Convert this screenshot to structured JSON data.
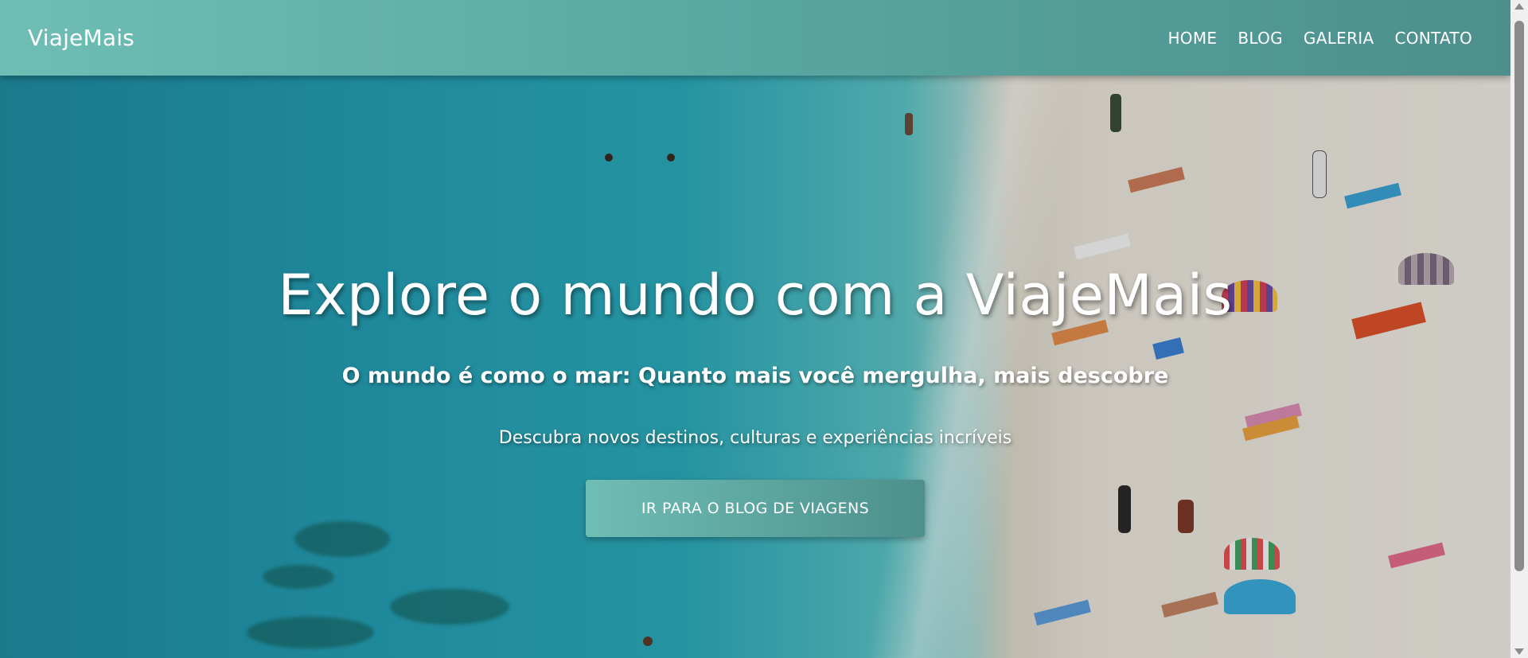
{
  "navbar": {
    "brand": "ViajeMais",
    "links": [
      "HOME",
      "BLOG",
      "GALERIA",
      "CONTATO"
    ]
  },
  "hero": {
    "title": "Explore o mundo com a ViajeMais",
    "subtitle": "O mundo é como o mar: Quanto mais você mergulha, mais descobre",
    "description": "Descubra novos destinos, culturas e experiências incríveis",
    "cta_label": "IR PARA O BLOG DE VIAGENS"
  },
  "colors": {
    "nav_start": "#6fbeb5",
    "nav_end": "#4d8f8c",
    "text": "#ffffff"
  }
}
